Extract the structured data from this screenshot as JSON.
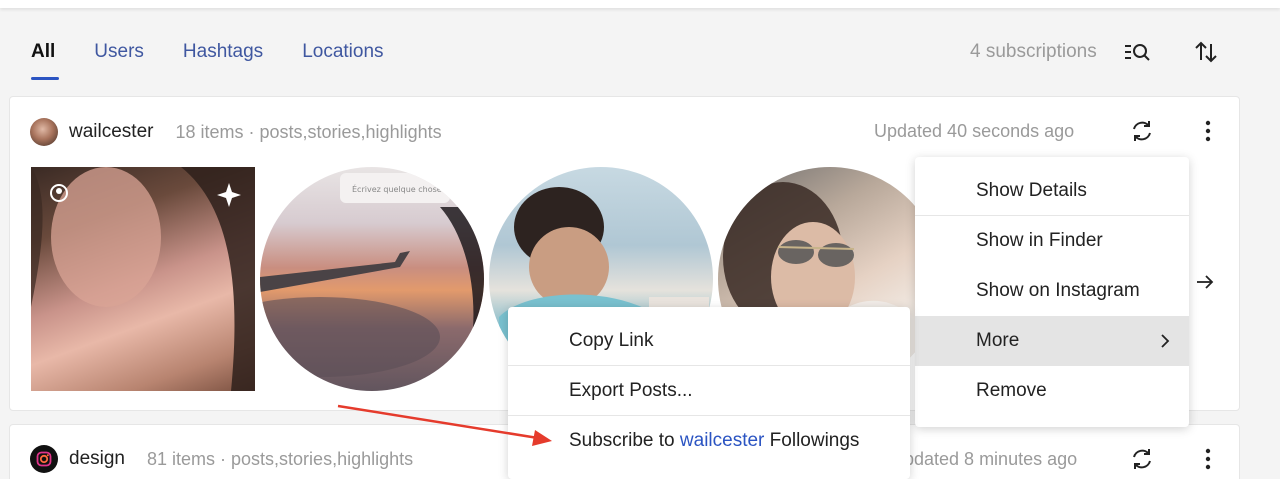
{
  "tabs": [
    {
      "label": "All",
      "active": true
    },
    {
      "label": "Users",
      "active": false
    },
    {
      "label": "Hashtags",
      "active": false
    },
    {
      "label": "Locations",
      "active": false
    }
  ],
  "toolbar": {
    "subscriptions_count": "4 subscriptions",
    "filter_icon": "filter-search-icon",
    "sort_icon": "sort-icon"
  },
  "subscriptions": [
    {
      "username": "wailcester",
      "meta": "18 items · posts,stories,highlights",
      "updated": "Updated 40 seconds ago",
      "avatar_icon": "user-avatar"
    },
    {
      "username": "design",
      "meta": "81 items · posts,stories,highlights",
      "updated": "pdated 8 minutes ago",
      "avatar_icon": "instagram-logo-avatar"
    }
  ],
  "context_menu": {
    "items": [
      {
        "label": "Show Details"
      },
      {
        "label": "Show in Finder"
      },
      {
        "label": "Show on Instagram"
      },
      {
        "label": "More",
        "has_submenu": true,
        "highlighted": true
      },
      {
        "label": "Remove"
      }
    ]
  },
  "submenu": {
    "items": [
      {
        "label": "Copy Link"
      },
      {
        "label": "Export Posts..."
      },
      {
        "label_prefix": "Subscribe to ",
        "label_accent": "wailcester",
        "label_suffix": " Followings"
      }
    ]
  },
  "thumb2_caption": "Écrivez quelque chose",
  "colors": {
    "accent": "#2b54c2",
    "annotation_arrow": "#e53b2c",
    "muted_text": "#9a9a9a"
  }
}
